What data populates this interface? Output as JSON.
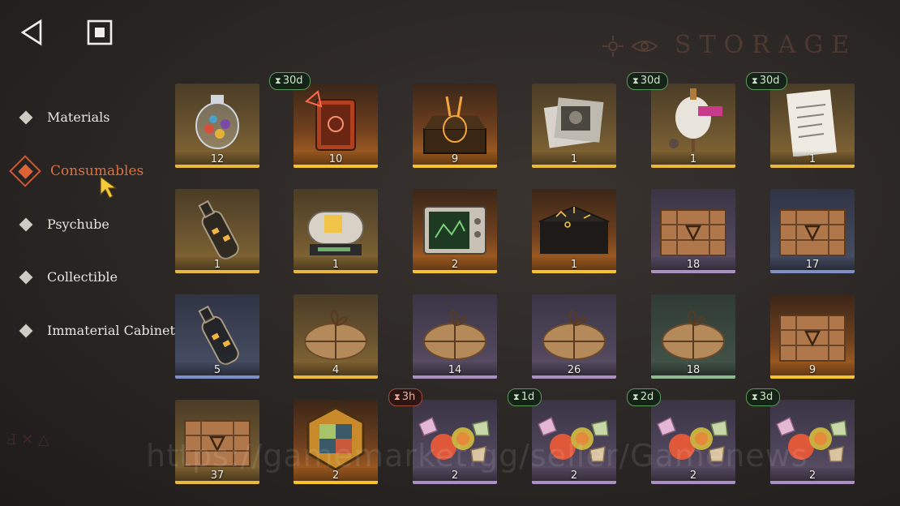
{
  "header": {
    "title": "STORAGE"
  },
  "sidebar": {
    "items": [
      {
        "label": "Materials",
        "active": false
      },
      {
        "label": "Consumables",
        "active": true
      },
      {
        "label": "Psychube",
        "active": false
      },
      {
        "label": "Collectible",
        "active": false
      },
      {
        "label": "Immaterial Cabinet",
        "active": false
      }
    ]
  },
  "items": [
    {
      "count": "12",
      "timer": "",
      "rarity": "gold",
      "icon": "candy-jar-icon"
    },
    {
      "count": "10",
      "timer": "30d",
      "rarity": "orange",
      "icon": "rune-book-icon"
    },
    {
      "count": "9",
      "timer": "",
      "rarity": "orange",
      "icon": "rabbit-statue-box-icon"
    },
    {
      "count": "1",
      "timer": "",
      "rarity": "gold",
      "icon": "photo-bundle-icon"
    },
    {
      "count": "1",
      "timer": "30d",
      "rarity": "gold",
      "icon": "tailor-mannequin-icon"
    },
    {
      "count": "1",
      "timer": "30d",
      "rarity": "gold",
      "icon": "shopping-list-icon"
    },
    {
      "count": "1",
      "timer": "",
      "rarity": "gold",
      "icon": "message-bottle-icon"
    },
    {
      "count": "1",
      "timer": "",
      "rarity": "gold",
      "icon": "capsule-machine-icon"
    },
    {
      "count": "2",
      "timer": "",
      "rarity": "orange",
      "icon": "old-tv-icon"
    },
    {
      "count": "1",
      "timer": "",
      "rarity": "orange",
      "icon": "rune-table-icon"
    },
    {
      "count": "18",
      "timer": "",
      "rarity": "purple",
      "icon": "wooden-crate-icon"
    },
    {
      "count": "17",
      "timer": "",
      "rarity": "blue",
      "icon": "wooden-crate-icon"
    },
    {
      "count": "5",
      "timer": "",
      "rarity": "blue",
      "icon": "message-bottle-icon"
    },
    {
      "count": "4",
      "timer": "",
      "rarity": "gold",
      "icon": "paper-parcel-icon"
    },
    {
      "count": "14",
      "timer": "",
      "rarity": "purple",
      "icon": "paper-parcel-icon"
    },
    {
      "count": "26",
      "timer": "",
      "rarity": "purple",
      "icon": "paper-parcel-icon"
    },
    {
      "count": "18",
      "timer": "",
      "rarity": "green",
      "icon": "paper-parcel-icon"
    },
    {
      "count": "9",
      "timer": "",
      "rarity": "orange",
      "icon": "wooden-crate-icon"
    },
    {
      "count": "37",
      "timer": "",
      "rarity": "gold",
      "icon": "wooden-crate-icon"
    },
    {
      "count": "2",
      "timer": "",
      "rarity": "orange",
      "icon": "stained-glass-medal-icon"
    },
    {
      "count": "2",
      "timer": "3h",
      "timer_style": "red",
      "rarity": "purple",
      "icon": "candy-pile-icon"
    },
    {
      "count": "2",
      "timer": "1d",
      "rarity": "purple",
      "icon": "candy-pile-icon"
    },
    {
      "count": "2",
      "timer": "2d",
      "rarity": "purple",
      "icon": "candy-pile-icon"
    },
    {
      "count": "2",
      "timer": "3d",
      "rarity": "purple",
      "icon": "candy-pile-icon"
    }
  ],
  "watermark": "https://gamemarket.gg/seller/Gamenews",
  "colors": {
    "accent": "#e06238",
    "timer_border": "#5a9a5a",
    "stripe_gold": "#e8b93c",
    "stripe_purple": "#a98fc2",
    "stripe_blue": "#7d8fc4",
    "stripe_green": "#8fb893"
  }
}
